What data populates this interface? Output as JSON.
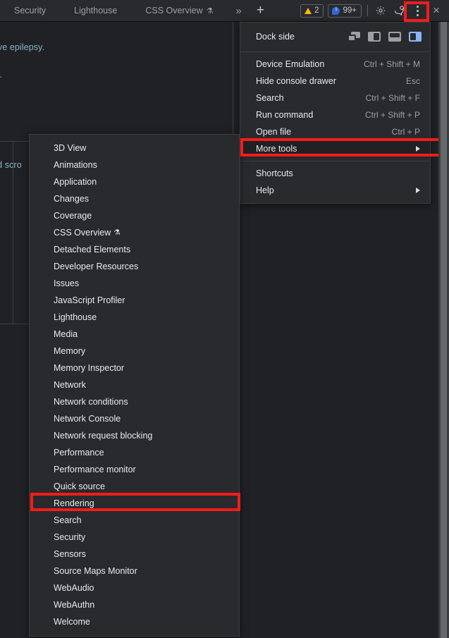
{
  "window": {
    "app": "Chrome DevTools",
    "theme_bg": "#202124",
    "menu_bg": "#292a2d",
    "accent_red": "#f41c1c",
    "accent_blue": "#8ab4f8"
  },
  "tabbar": {
    "tabs": [
      {
        "label": "Security",
        "experimental": false
      },
      {
        "label": "Lighthouse",
        "experimental": false
      },
      {
        "label": "CSS Overview",
        "experimental": true,
        "flask": "⚗"
      }
    ],
    "overflow_icon": "»",
    "add_tab_icon": "+",
    "badges": [
      {
        "icon": "warning-triangle",
        "count": "2",
        "color": "#fbbc04"
      },
      {
        "icon": "info-bubble",
        "count": "99+",
        "color": "#3367d6"
      }
    ],
    "settings_icon": "gear-icon",
    "feedback_icon": "feedback-icon",
    "more_options_icon": "three-dot-vertical",
    "close_icon": "×"
  },
  "background": {
    "lines": [
      "ive epilepsy.",
      "y.",
      "ead scro"
    ]
  },
  "main_menu": {
    "dock": {
      "label": "Dock side",
      "options": [
        {
          "name": "undock-into-separate-window",
          "selected": false
        },
        {
          "name": "dock-to-left",
          "selected": false
        },
        {
          "name": "dock-to-bottom",
          "selected": false
        },
        {
          "name": "dock-to-right",
          "selected": true
        }
      ]
    },
    "group1": [
      {
        "label": "Device Emulation",
        "accel": "Ctrl + Shift + M",
        "arrow": false,
        "highlighted": false
      },
      {
        "label": "Hide console drawer",
        "accel": "Esc",
        "arrow": false,
        "highlighted": false
      },
      {
        "label": "Search",
        "accel": "Ctrl + Shift + F",
        "arrow": false,
        "highlighted": false
      },
      {
        "label": "Run command",
        "accel": "Ctrl + Shift + P",
        "arrow": false,
        "highlighted": false
      },
      {
        "label": "Open file",
        "accel": "Ctrl + P",
        "arrow": false,
        "highlighted": false
      },
      {
        "label": "More tools",
        "accel": "",
        "arrow": true,
        "highlighted": true
      }
    ],
    "group2": [
      {
        "label": "Shortcuts",
        "accel": "",
        "arrow": false,
        "highlighted": false
      },
      {
        "label": "Help",
        "accel": "",
        "arrow": true,
        "highlighted": false
      }
    ]
  },
  "submenu": {
    "title": "More tools",
    "items": [
      {
        "label": "3D View",
        "experimental": false,
        "highlighted": false
      },
      {
        "label": "Animations",
        "experimental": false,
        "highlighted": false
      },
      {
        "label": "Application",
        "experimental": false,
        "highlighted": false
      },
      {
        "label": "Changes",
        "experimental": false,
        "highlighted": false
      },
      {
        "label": "Coverage",
        "experimental": false,
        "highlighted": false
      },
      {
        "label": "CSS Overview",
        "experimental": true,
        "flask": "⚗",
        "highlighted": false
      },
      {
        "label": "Detached Elements",
        "experimental": false,
        "highlighted": false
      },
      {
        "label": "Developer Resources",
        "experimental": false,
        "highlighted": false
      },
      {
        "label": "Issues",
        "experimental": false,
        "highlighted": false
      },
      {
        "label": "JavaScript Profiler",
        "experimental": false,
        "highlighted": false
      },
      {
        "label": "Lighthouse",
        "experimental": false,
        "highlighted": false
      },
      {
        "label": "Media",
        "experimental": false,
        "highlighted": false
      },
      {
        "label": "Memory",
        "experimental": false,
        "highlighted": false
      },
      {
        "label": "Memory Inspector",
        "experimental": false,
        "highlighted": false
      },
      {
        "label": "Network",
        "experimental": false,
        "highlighted": false
      },
      {
        "label": "Network conditions",
        "experimental": false,
        "highlighted": false
      },
      {
        "label": "Network Console",
        "experimental": false,
        "highlighted": false
      },
      {
        "label": "Network request blocking",
        "experimental": false,
        "highlighted": false
      },
      {
        "label": "Performance",
        "experimental": false,
        "highlighted": false
      },
      {
        "label": "Performance monitor",
        "experimental": false,
        "highlighted": false
      },
      {
        "label": "Quick source",
        "experimental": false,
        "highlighted": false
      },
      {
        "label": "Rendering",
        "experimental": false,
        "highlighted": true
      },
      {
        "label": "Search",
        "experimental": false,
        "highlighted": false
      },
      {
        "label": "Security",
        "experimental": false,
        "highlighted": false
      },
      {
        "label": "Sensors",
        "experimental": false,
        "highlighted": false
      },
      {
        "label": "Source Maps Monitor",
        "experimental": false,
        "highlighted": false
      },
      {
        "label": "WebAudio",
        "experimental": false,
        "highlighted": false
      },
      {
        "label": "WebAuthn",
        "experimental": false,
        "highlighted": false
      },
      {
        "label": "Welcome",
        "experimental": false,
        "highlighted": false
      }
    ]
  },
  "annotations": [
    {
      "target": "more-options-button",
      "color": "#f41c1c"
    },
    {
      "target": "menu-item-more-tools",
      "color": "#f41c1c"
    },
    {
      "target": "submenu-item-rendering",
      "color": "#f41c1c"
    }
  ]
}
